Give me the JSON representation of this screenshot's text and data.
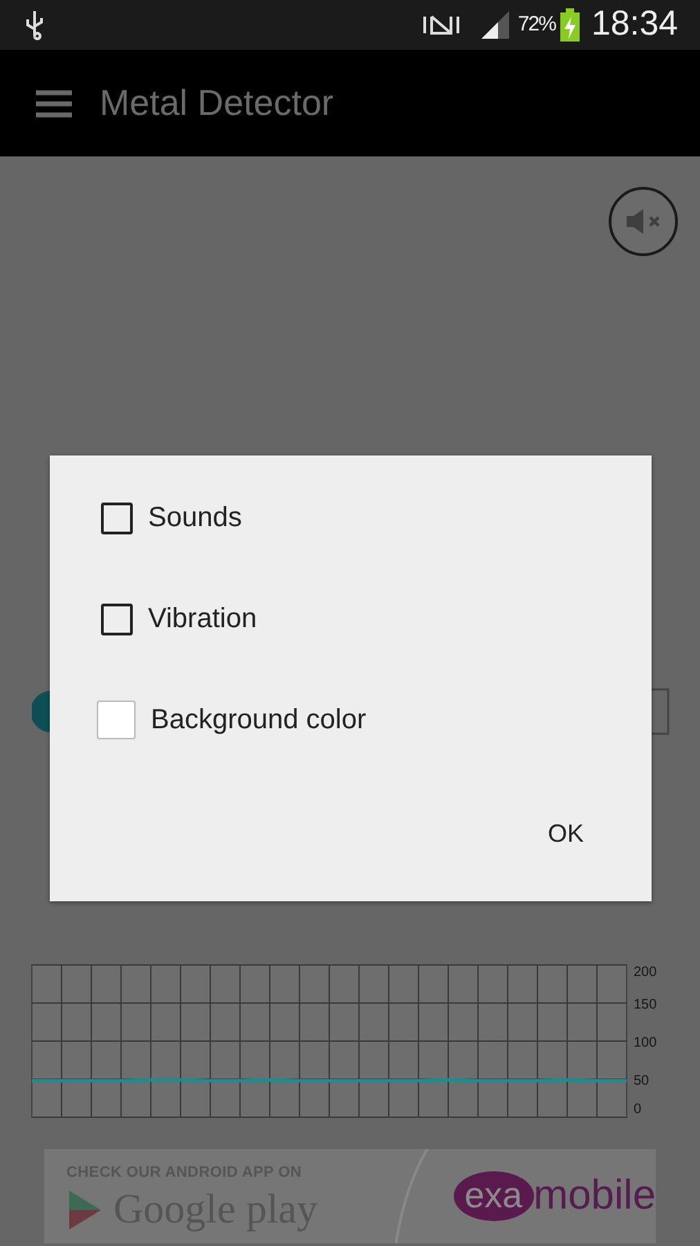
{
  "status_bar": {
    "battery": "72%",
    "battery_charging": true,
    "time": "18:34"
  },
  "app_bar": {
    "title": "Metal Detector"
  },
  "dialog": {
    "options": [
      {
        "label": "Sounds",
        "checked": false,
        "kind": "outline"
      },
      {
        "label": "Vibration",
        "checked": false,
        "kind": "outline"
      },
      {
        "label": "Background color",
        "checked": false,
        "kind": "filled"
      }
    ],
    "ok": "OK"
  },
  "chart": {
    "chart_data": {
      "type": "line",
      "grid": true,
      "ylim": [
        0,
        200
      ],
      "yticks": [
        0,
        50,
        100,
        150,
        200
      ],
      "series": [
        {
          "color": "#1f8d8f",
          "values": [
            48,
            48,
            48,
            48,
            49,
            49,
            48,
            48,
            49,
            48,
            48,
            48,
            48,
            48,
            49,
            48,
            48,
            48,
            49,
            48,
            48
          ]
        }
      ]
    }
  },
  "ad": {
    "tagline": "CHECK OUR ANDROID APP ON",
    "store": "Google play",
    "logo_badge": "exa",
    "logo_word": "mobile"
  }
}
